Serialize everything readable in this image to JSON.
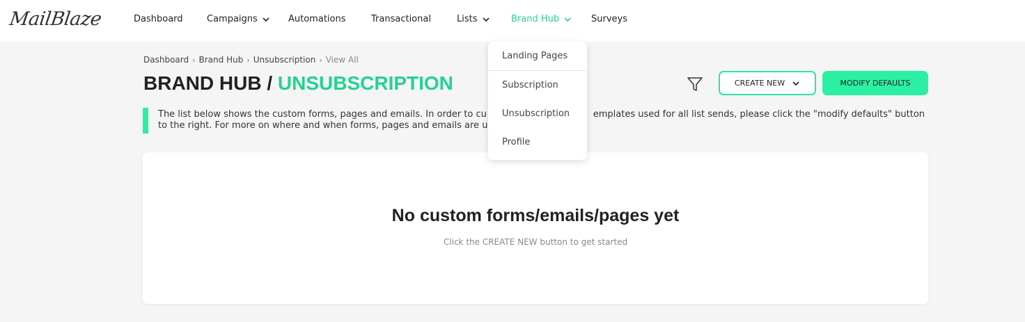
{
  "brand": {
    "logo_text": "MailBlaze"
  },
  "nav": {
    "items": [
      {
        "label": "Dashboard"
      },
      {
        "label": "Campaigns",
        "has_dropdown": true
      },
      {
        "label": "Automations"
      },
      {
        "label": "Transactional"
      },
      {
        "label": "Lists",
        "has_dropdown": true
      },
      {
        "label": "Brand Hub",
        "has_dropdown": true,
        "active": true
      },
      {
        "label": "Surveys"
      }
    ],
    "active_color": "#2ecf8d"
  },
  "dropdown": {
    "items": [
      {
        "label": "Landing Pages"
      },
      {
        "label": "Subscription"
      },
      {
        "label": "Unsubscription"
      },
      {
        "label": "Profile"
      }
    ]
  },
  "breadcrumb": {
    "items": [
      "Dashboard",
      "Brand Hub",
      "Unsubscription",
      "View All"
    ]
  },
  "page": {
    "title_prefix": "BRAND HUB /",
    "title_accent": "UNSUBSCRIPTION",
    "accent_color": "#23d38f"
  },
  "toolbar": {
    "filter_icon": "filter-icon",
    "create_label": "CREATE NEW",
    "defaults_label": "MODIFY DEFAULTS",
    "button_color": "#2bf0a3"
  },
  "notice": {
    "text": "The list below shows the custom forms, pages and emails. In order to cu                                     emplates used for all list sends, please click the \"modify defaults\" button to the right. For more on where and when forms, pages and emails are u"
  },
  "empty_state": {
    "title": "No custom forms/emails/pages yet",
    "subtitle": "Click the CREATE NEW button to get started"
  }
}
